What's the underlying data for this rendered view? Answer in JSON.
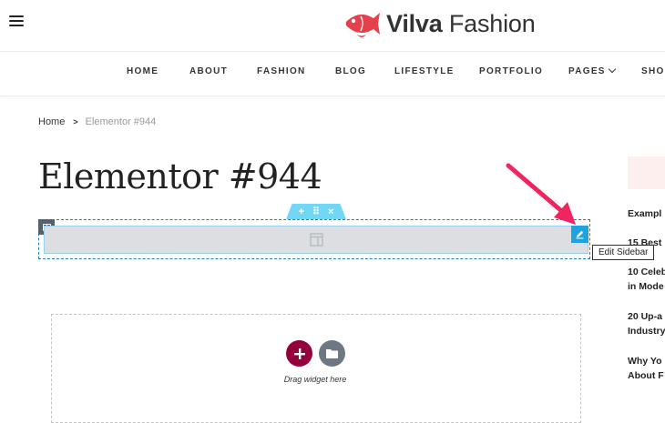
{
  "header": {
    "brand_bold": "Vilva",
    "brand_light": "Fashion"
  },
  "nav": {
    "items": [
      "HOME",
      "ABOUT",
      "FASHION",
      "BLOG",
      "LIFESTYLE",
      "PORTFOLIO",
      "PAGES",
      "SHO"
    ]
  },
  "breadcrumb": {
    "home": "Home",
    "separator": ">",
    "current": "Elementor #944"
  },
  "page": {
    "title": "Elementor #944"
  },
  "editor": {
    "section_handle": {
      "add": "+",
      "move": "⠿",
      "close": "×"
    },
    "tooltip": "Edit Sidebar",
    "drag_hint": "Drag widget here"
  },
  "sidebar": {
    "lines": [
      "Exampl",
      "15 Best",
      "10 Celeb",
      "in Mode",
      "20 Up-a",
      "Industry",
      "Why Yo",
      "About F"
    ]
  },
  "colors": {
    "accent_red": "#e5414d",
    "elementor_blue": "#71d7f7",
    "edit_button": "#1ea3e0",
    "add_button": "#93003c",
    "template_button": "#6d7882",
    "arrow_pink": "#f0245f"
  }
}
